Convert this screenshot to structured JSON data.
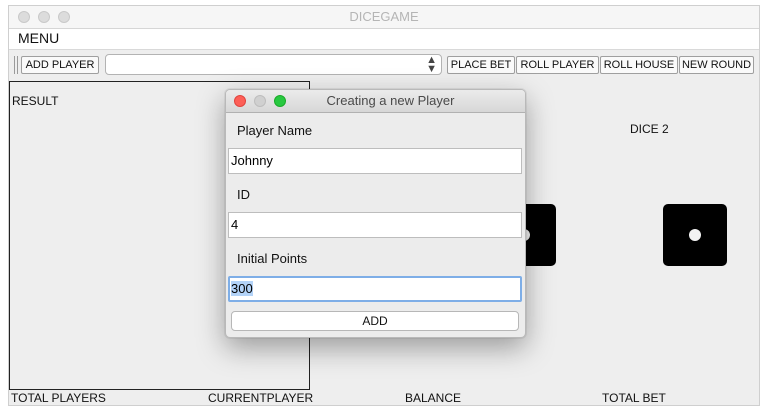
{
  "window": {
    "title": "DICEGAME"
  },
  "menubar": {
    "items": [
      "MENU"
    ]
  },
  "toolbar": {
    "add_player": "ADD PLAYER",
    "player_select_value": "",
    "place_bet": "PLACE BET",
    "roll_player": "ROLL PLAYER",
    "roll_house": "ROLL HOUSE",
    "new_round": "NEW ROUND"
  },
  "result_panel": {
    "label": "RESULT"
  },
  "dice": {
    "dice2_label": "DICE 2",
    "dice1_value": 1,
    "dice2_value": 1
  },
  "status_bar": {
    "total_players": "TOTAL PLAYERS",
    "current_player": "CURRENTPLAYER",
    "balance": "BALANCE",
    "total_bet": "TOTAL BET"
  },
  "dialog": {
    "title": "Creating a new Player",
    "name_label": "Player Name",
    "name_value": "Johnny",
    "id_label": "ID",
    "id_value": "4",
    "points_label": "Initial Points",
    "points_value": "300",
    "add_button": "ADD"
  },
  "colors": {
    "close": "#fd5f57",
    "minimize": "#febc2e",
    "zoom": "#28c840",
    "focus_ring": "#7eaee7",
    "selection": "#b3d3f8"
  }
}
